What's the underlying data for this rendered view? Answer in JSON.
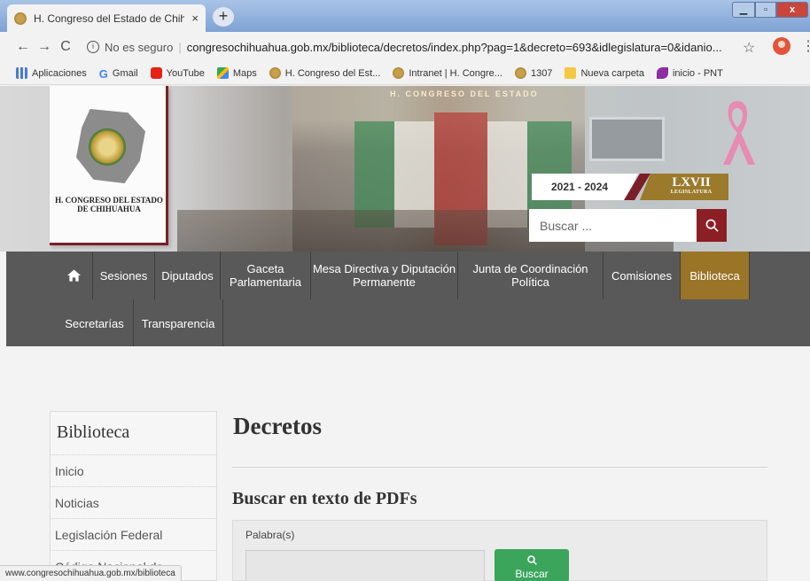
{
  "browser": {
    "tab_title": "H. Congreso del Estado de Chihu",
    "tab_close": "×",
    "new_tab": "+",
    "window_controls": {
      "minimize": "▁",
      "maximize": "▫",
      "close": "x"
    },
    "nav": {
      "back": "←",
      "forward": "→",
      "reload": "C"
    },
    "security_label": "No es seguro",
    "separator": "|",
    "url": "congresochihuahua.gob.mx/biblioteca/decretos/index.php?pag=1&decreto=693&idlegislatura=0&idanio...",
    "bookmarks": [
      {
        "label": "Aplicaciones",
        "icon": "apps-icon"
      },
      {
        "label": "Gmail",
        "icon": "google-icon"
      },
      {
        "label": "YouTube",
        "icon": "youtube-icon"
      },
      {
        "label": "Maps",
        "icon": "maps-icon"
      },
      {
        "label": "H. Congreso del Est...",
        "icon": "seal-icon"
      },
      {
        "label": "Intranet | H. Congre...",
        "icon": "seal-icon"
      },
      {
        "label": "1307",
        "icon": "seal-icon"
      },
      {
        "label": "Nueva carpeta",
        "icon": "folder-icon"
      },
      {
        "label": "inicio - PNT",
        "icon": "pnt-icon"
      }
    ],
    "status_url": "www.congresochihuahua.gob.mx/biblioteca"
  },
  "header": {
    "hall_title": "H. CONGRESO DEL ESTADO",
    "logo_line1": "H. CONGRESO DEL ESTADO",
    "logo_line2": "DE CHIHUAHUA",
    "years": "2021 - 2024",
    "legislature_number": "LXVII",
    "legislature_word": "LEGISLATURA",
    "search_placeholder": "Buscar ...",
    "search_icon": "search-icon"
  },
  "nav": {
    "home_icon": "home-icon",
    "items": [
      {
        "label": "Sesiones"
      },
      {
        "label": "Diputados"
      },
      {
        "label": "Gaceta Parlamentaria"
      },
      {
        "label": "Mesa Directiva y Diputación Permanente"
      },
      {
        "label": "Junta de Coordinación Política"
      },
      {
        "label": "Comisiones"
      },
      {
        "label": "Biblioteca",
        "active": true
      },
      {
        "label": "Secretarías"
      },
      {
        "label": "Transparencia"
      }
    ]
  },
  "sidebar": {
    "title": "Biblioteca",
    "items": [
      {
        "label": "Inicio"
      },
      {
        "label": "Noticias"
      },
      {
        "label": "Legislación Federal"
      },
      {
        "label": "Código Nacional de"
      }
    ]
  },
  "main": {
    "title": "Decretos",
    "subtitle": "Buscar en texto de PDFs",
    "field_label": "Palabra(s)",
    "button_label": "Buscar"
  },
  "colors": {
    "nav_bg": "#595959",
    "nav_active": "#9a7427",
    "brand_red": "#8c1e25",
    "button_green": "#3ba55c"
  }
}
